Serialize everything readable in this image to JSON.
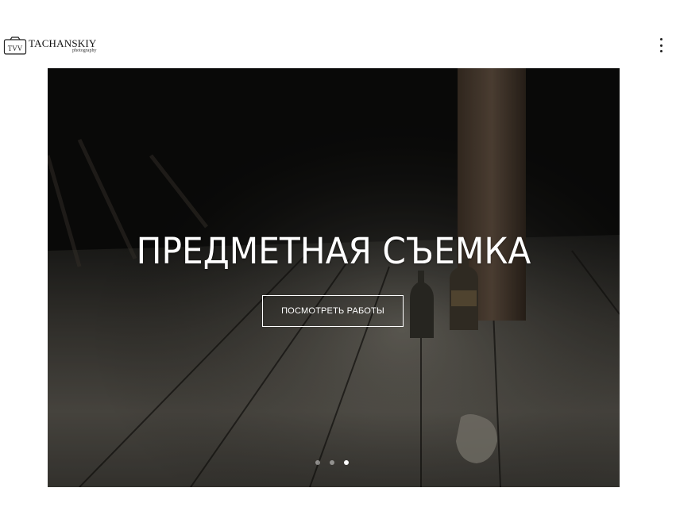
{
  "header": {
    "logo_name": "TACHANSKIY",
    "logo_sub": "photography",
    "logo_mark": "TVV"
  },
  "hero": {
    "title": "ПРЕДМЕТНАЯ СЪЕМКА",
    "button_label": "ПОСМОТРЕТЬ РАБОТЫ",
    "slides_count": 3,
    "active_slide": 3
  },
  "colors": {
    "background": "#ffffff",
    "hero_text": "#ffffff",
    "menu_dots": "#222222"
  },
  "icons": {
    "menu": "more-vertical-icon",
    "logo": "camera-logo-icon"
  }
}
